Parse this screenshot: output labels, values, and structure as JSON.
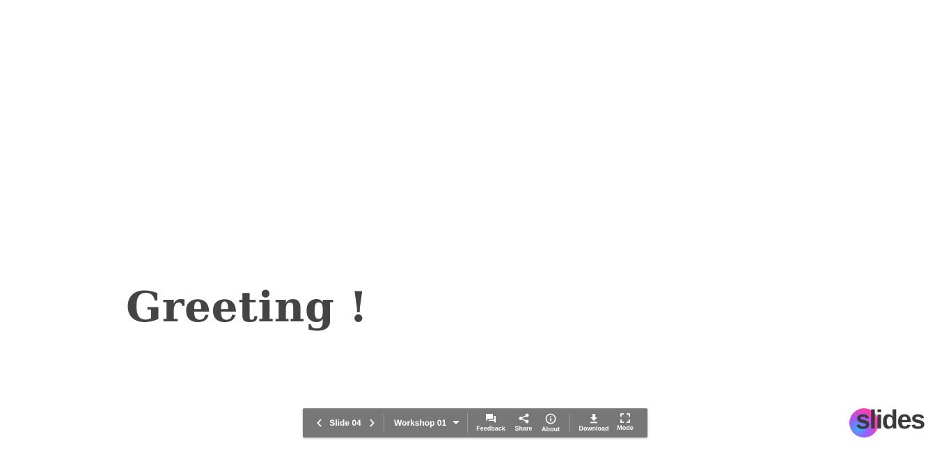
{
  "slide": {
    "title": "Greeting !"
  },
  "toolbar": {
    "current_slide": "Slide 04",
    "deck_name": "Workshop 01",
    "feedback_label": "Feedback",
    "share_label": "Share",
    "about_label": "About",
    "download_label": "Download",
    "mode_label": "Mode",
    "icons": [
      "chevron-left-icon",
      "chevron-right-icon",
      "caret-down-icon",
      "chat-icon",
      "share-icon",
      "info-icon",
      "download-icon",
      "fullscreen-icon"
    ]
  },
  "branding": {
    "logo_text": "slides"
  },
  "colors": {
    "background": "#ffffff",
    "title_text": "#444444",
    "toolbar_bg": "#777777",
    "toolbar_text": "#ffffff",
    "logo_gradient": [
      "#3ab0ff",
      "#9b5cff",
      "#ff3da8"
    ]
  }
}
